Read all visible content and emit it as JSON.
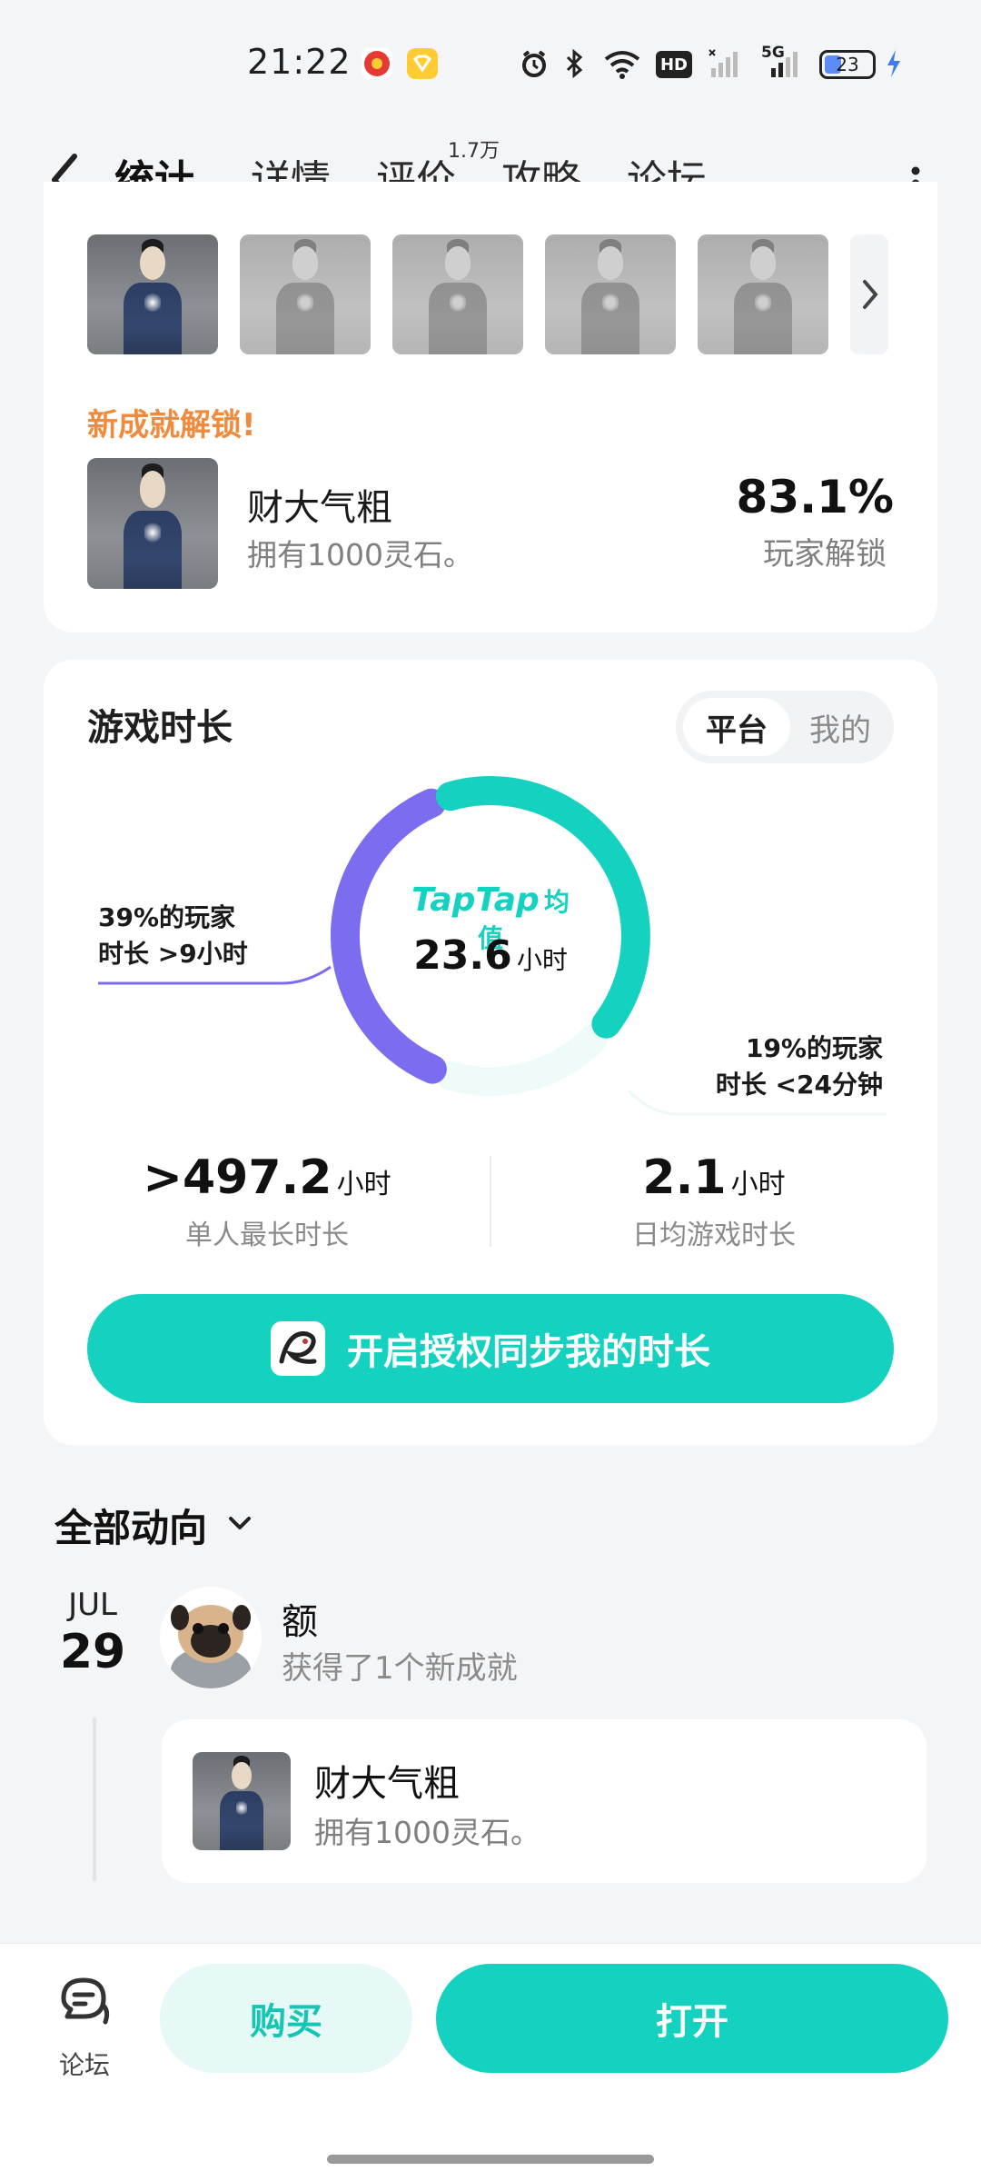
{
  "status_bar": {
    "time": "21:22",
    "network": "5G",
    "hd_badge": "HD",
    "battery": "23"
  },
  "nav": {
    "tabs": [
      {
        "label": "统计",
        "active": true
      },
      {
        "label": "详情",
        "active": false
      },
      {
        "label": "评价",
        "active": false
      },
      {
        "label": "攻略",
        "active": false
      },
      {
        "label": "论坛",
        "active": false
      }
    ],
    "rating_count": "1.7万"
  },
  "achievement": {
    "unlock_title": "新成就解锁!",
    "name": "财大气粗",
    "desc": "拥有1000灵石。",
    "percent": "83.1%",
    "percent_label": "玩家解锁"
  },
  "playtime": {
    "title": "游戏时长",
    "toggle": {
      "options": [
        "平台",
        "我的"
      ],
      "selected": "平台"
    },
    "center_brand": "TapTap",
    "center_label": "均值",
    "avg_value": "23.6",
    "avg_unit": "小时",
    "left_note": {
      "line1": "39%的玩家",
      "line2": "时长 >9小时"
    },
    "right_note": {
      "line1": "19%的玩家",
      "line2": "时长 <24分钟"
    },
    "donut_fractions": {
      "teal": 0.42,
      "purple": 0.39,
      "pale": 0.19
    },
    "max_value": ">497.2",
    "max_unit": "小时",
    "max_label": "单人最长时长",
    "daily_value": "2.1",
    "daily_unit": "小时",
    "daily_label": "日均游戏时长",
    "sync_button": "开启授权同步我的时长"
  },
  "feed": {
    "title": "全部动向",
    "date_month": "JUL",
    "date_day": "29",
    "user": "额",
    "action": "获得了1个新成就",
    "item_name": "财大气粗",
    "item_desc": "拥有1000灵石。"
  },
  "bottom_bar": {
    "forum_label": "论坛",
    "buy_label": "购买",
    "open_label": "打开"
  },
  "colors": {
    "accent": "#15d2c0",
    "purple": "#7b6cf0",
    "orange": "#f08a3c"
  }
}
